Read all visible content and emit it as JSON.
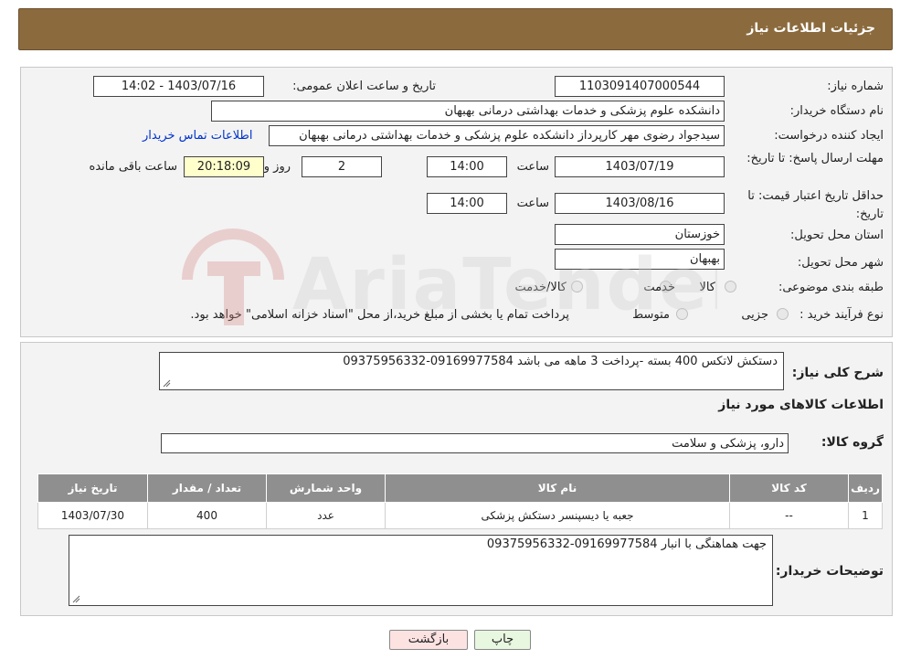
{
  "header": {
    "title": "جزئیات اطلاعات نیاز"
  },
  "form": {
    "need_number_label": "شماره نیاز:",
    "need_number": "1103091407000544",
    "announce_label": "تاریخ و ساعت اعلان عمومی:",
    "announce_value": "1403/07/16 - 14:02",
    "buyer_org_label": "نام دستگاه خریدار:",
    "buyer_org": "دانشکده علوم پزشکی و خدمات بهداشتی  درمانی بهبهان",
    "creator_label": "ایجاد کننده درخواست:",
    "creator": "سیدجواد رضوی مهر کارپرداز دانشکده علوم پزشکی و خدمات بهداشتی  درمانی بهبهان",
    "contact_link": "اطلاعات تماس خریدار",
    "deadline_label": "مهلت ارسال پاسخ: تا تاریخ:",
    "deadline_date": "1403/07/19",
    "time_label": "ساعت",
    "deadline_time": "14:00",
    "days_value": "2",
    "days_label": "روز و",
    "remaining_value": "20:18:09",
    "remaining_label": "ساعت باقی مانده",
    "validity_label": "حداقل تاریخ اعتبار قیمت: تا تاریخ:",
    "validity_date": "1403/08/16",
    "validity_time": "14:00",
    "province_label": "استان محل تحویل:",
    "province": "خوزستان",
    "city_label": "شهر محل تحویل:",
    "city": "بهبهان",
    "category_label": "طبقه بندی موضوعی:",
    "category_options": [
      "کالا",
      "خدمت",
      "کالا/خدمت"
    ],
    "process_label": "نوع فرآیند خرید :",
    "process_options": [
      "جزیی",
      "متوسط"
    ],
    "process_note": "پرداخت تمام یا بخشی از مبلغ خرید،از محل \"اسناد خزانه اسلامی\" خواهد بود."
  },
  "details": {
    "description_label": "شرح کلی نیاز:",
    "description": "دستکش لاتکس 400 بسته -پرداخت 3 ماهه می باشد 09169977584-09375956332",
    "items_title": "اطلاعات کالاهای مورد نیاز",
    "group_label": "گروه کالا:",
    "group_value": "دارو، پزشکی و سلامت",
    "table": {
      "headers": [
        "ردیف",
        "کد کالا",
        "نام کالا",
        "واحد شمارش",
        "تعداد / مقدار",
        "تاریخ نیاز"
      ],
      "rows": [
        [
          "1",
          "--",
          "جعبه یا دیسپنسر دستکش پزشکی",
          "عدد",
          "400",
          "1403/07/30"
        ]
      ]
    },
    "buyer_notes_label": "توضیحات خریدار:",
    "buyer_notes": "جهت هماهنگی با انبار 09169977584-09375956332"
  },
  "buttons": {
    "print": "چاپ",
    "back": "بازگشت"
  },
  "colors": {
    "header": "#8b6b3e",
    "table_header": "#8f8f8f",
    "remaining_bg": "#ffffcc",
    "link": "#0033cc"
  },
  "watermark": "AriaTender.neT"
}
